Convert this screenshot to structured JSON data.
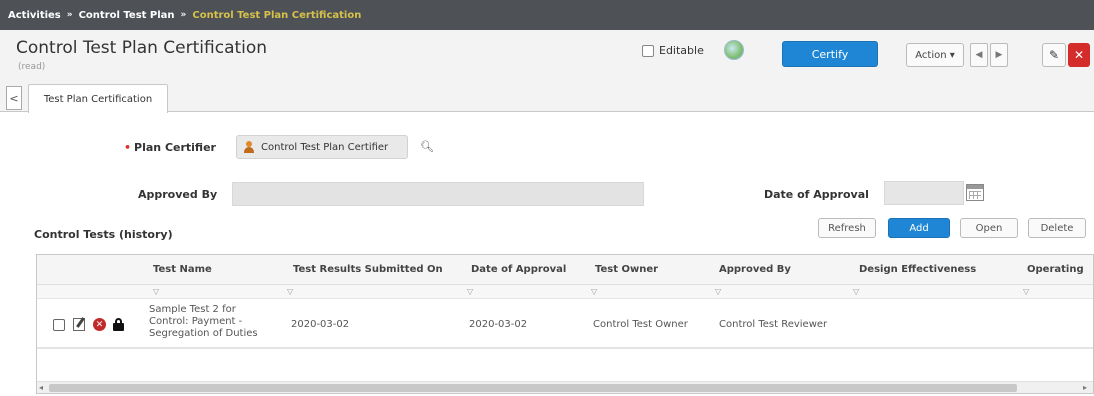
{
  "breadcrumb": {
    "items": [
      "Activities",
      "Control Test Plan",
      "Control Test Plan Certification"
    ],
    "separator": "»"
  },
  "header": {
    "title": "Control Test Plan Certification",
    "subtitle": "(read)",
    "editable_label": "Editable",
    "certify_label": "Certify",
    "action_label": "Action ▾"
  },
  "tabs": {
    "active": "Test Plan Certification"
  },
  "form": {
    "plan_certifier_label": "Plan Certifier",
    "plan_certifier_value": "Control Test Plan Certifier",
    "approved_by_label": "Approved By",
    "date_of_approval_label": "Date of Approval"
  },
  "section": {
    "title": "Control Tests (history)",
    "buttons": {
      "refresh": "Refresh",
      "add": "Add",
      "open": "Open",
      "delete": "Delete"
    }
  },
  "grid": {
    "columns": [
      "Test Name",
      "Test Results Submitted On",
      "Date of Approval",
      "Test Owner",
      "Approved By",
      "Design Effectiveness",
      "Operating"
    ],
    "rows": [
      {
        "test_name_line1": "Sample Test 2 for",
        "test_name_line2": "Control: Payment -",
        "test_name_line3": "Segregation of Duties",
        "submitted_on": "2020-03-02",
        "date_of_approval": "2020-03-02",
        "test_owner": "Control Test Owner",
        "approved_by": "Control Test Reviewer"
      }
    ]
  },
  "colors": {
    "breadcrumb_bg": "#4e5257",
    "breadcrumb_current": "#d6c14a",
    "primary": "#1f86d6",
    "danger": "#d42b2b"
  }
}
